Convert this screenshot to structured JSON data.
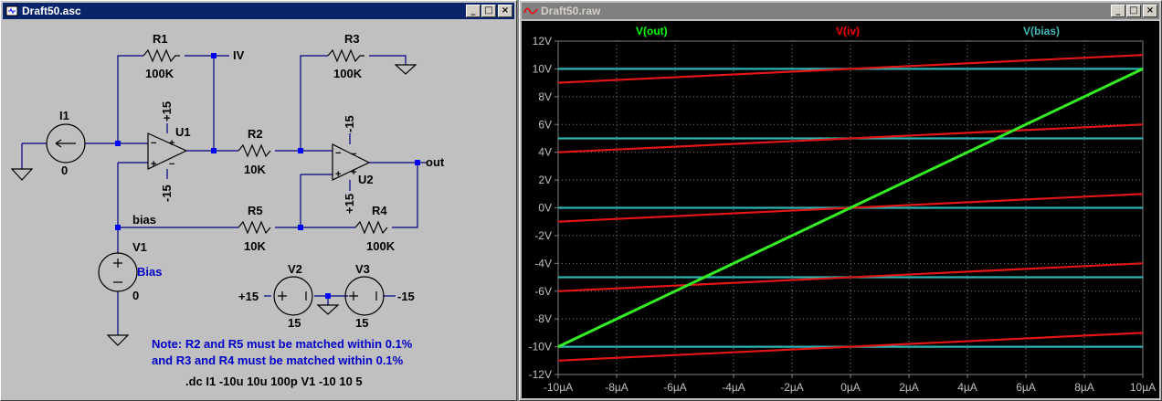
{
  "schematic_window": {
    "title": "Draft50.asc",
    "buttons": [
      "_",
      "□",
      "×"
    ],
    "components": {
      "r1": {
        "ref": "R1",
        "value": "100K"
      },
      "r2": {
        "ref": "R2",
        "value": "10K"
      },
      "r3": {
        "ref": "R3",
        "value": "100K"
      },
      "r4": {
        "ref": "R4",
        "value": "100K"
      },
      "r5": {
        "ref": "R5",
        "value": "10K"
      },
      "i1": {
        "ref": "I1",
        "value": "0"
      },
      "v1": {
        "ref": "V1",
        "value": "0",
        "label": "Bias"
      },
      "v2": {
        "ref": "V2",
        "value": "15"
      },
      "v3": {
        "ref": "V3",
        "value": "15"
      },
      "u1": {
        "ref": "U1",
        "vplus": "+15",
        "vminus": "-15"
      },
      "u2": {
        "ref": "U2",
        "vplus": "+15",
        "vminus": "-15"
      }
    },
    "nets": {
      "iv": "IV",
      "out": "out",
      "bias": "bias",
      "plus15": "+15",
      "minus15": "-15"
    },
    "note_line1": "Note: R2 and R5 must be matched within 0.1%",
    "note_line2": "and  R3 and R4 must be matched within 0.1%",
    "directive": ".dc I1 -10u 10u 100p V1 -10 10 5",
    "note_color": "#0000c8"
  },
  "waveform_window": {
    "title": "Draft50.raw",
    "buttons": [
      "_",
      "□",
      "×"
    ],
    "legend": [
      {
        "name": "V(out)",
        "color": "#00ff00"
      },
      {
        "name": "V(iv)",
        "color": "#ff0000"
      },
      {
        "name": "V(bias)",
        "color": "#3fb8b8"
      }
    ]
  },
  "chart_data": {
    "type": "line",
    "xlim": [
      -10,
      10
    ],
    "ylim": [
      -12,
      12
    ],
    "x_ticks": [
      "-10µA",
      "-8µA",
      "-6µA",
      "-4µA",
      "-2µA",
      "0µA",
      "2µA",
      "4µA",
      "6µA",
      "8µA",
      "10µA"
    ],
    "y_ticks": [
      "-12V",
      "-10V",
      "-8V",
      "-6V",
      "-4V",
      "-2V",
      "0V",
      "2V",
      "4V",
      "6V",
      "8V",
      "10V",
      "12V"
    ],
    "grid": true,
    "legend_position": "top",
    "series": [
      {
        "name": "V(out)",
        "color": "#33ee22",
        "x": [
          -10,
          10
        ],
        "y": [
          -10,
          10
        ]
      },
      {
        "name": "V(iv)",
        "color": "#e31515",
        "x": [
          -10,
          10
        ],
        "y": [
          -11,
          -9
        ]
      },
      {
        "name": "V(iv)",
        "color": "#e31515",
        "x": [
          -10,
          10
        ],
        "y": [
          -6,
          -4
        ]
      },
      {
        "name": "V(iv)",
        "color": "#e31515",
        "x": [
          -10,
          10
        ],
        "y": [
          -1,
          1
        ]
      },
      {
        "name": "V(iv)",
        "color": "#e31515",
        "x": [
          -10,
          10
        ],
        "y": [
          4,
          6
        ]
      },
      {
        "name": "V(iv)",
        "color": "#e31515",
        "x": [
          -10,
          10
        ],
        "y": [
          9,
          11
        ]
      },
      {
        "name": "V(bias)",
        "color": "#2fb4b4",
        "x": [
          -10,
          10
        ],
        "y": [
          -10,
          -10
        ]
      },
      {
        "name": "V(bias)",
        "color": "#2fb4b4",
        "x": [
          -10,
          10
        ],
        "y": [
          -5,
          -5
        ]
      },
      {
        "name": "V(bias)",
        "color": "#2fb4b4",
        "x": [
          -10,
          10
        ],
        "y": [
          0,
          0
        ]
      },
      {
        "name": "V(bias)",
        "color": "#2fb4b4",
        "x": [
          -10,
          10
        ],
        "y": [
          5,
          5
        ]
      },
      {
        "name": "V(bias)",
        "color": "#2fb4b4",
        "x": [
          -10,
          10
        ],
        "y": [
          10,
          10
        ]
      }
    ]
  }
}
